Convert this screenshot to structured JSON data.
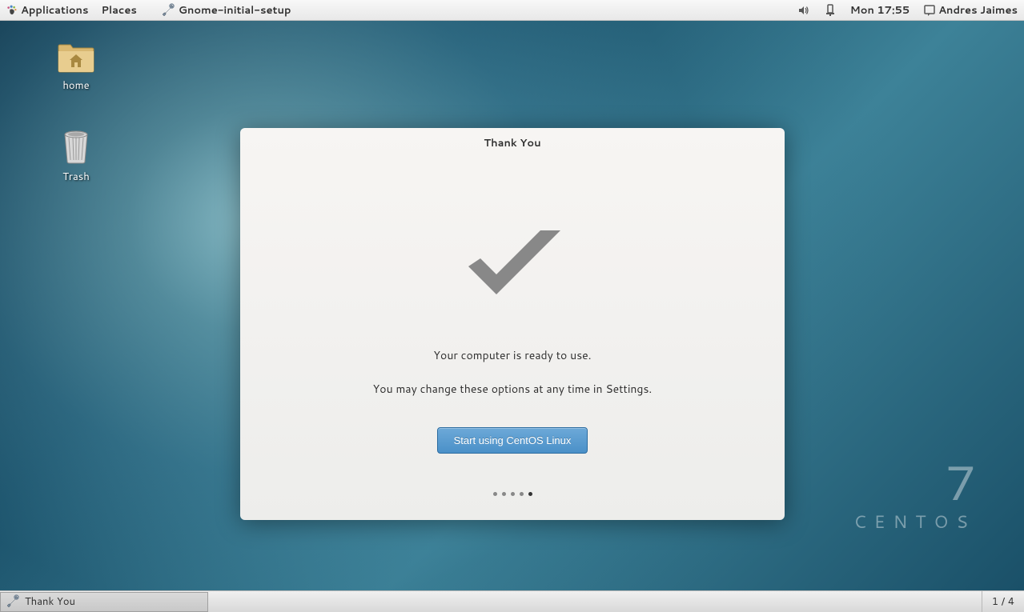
{
  "topPanel": {
    "applications": "Applications",
    "places": "Places",
    "currentApp": "Gnome-initial-setup",
    "clock": "Mon 17:55",
    "userName": "Andres Jaimes"
  },
  "desktopIcons": {
    "home": "home",
    "trash": "Trash"
  },
  "branding": {
    "version": "7",
    "name": "CENTOS"
  },
  "dialog": {
    "title": "Thank You",
    "mainText": "Your computer is ready to use.",
    "subText": "You may change these options at any time in Settings.",
    "buttonLabel": "Start using CentOS Linux"
  },
  "bottomPanel": {
    "taskItem": "Thank You",
    "workspace": "1 / 4"
  }
}
